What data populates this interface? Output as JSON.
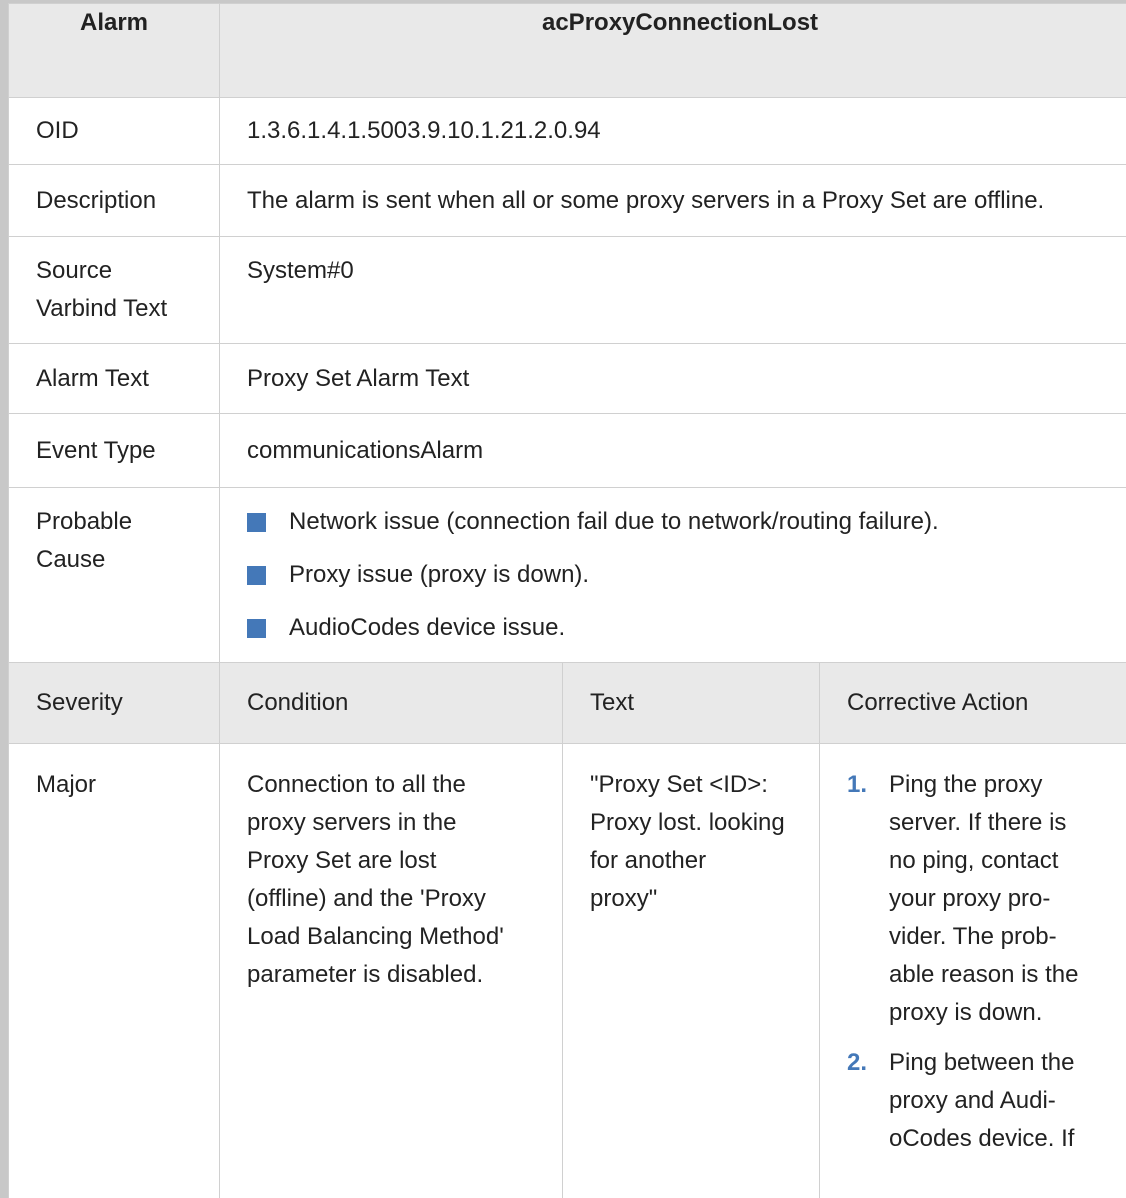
{
  "header": {
    "col_label": "Alarm",
    "col_value": "acProxyConnectionLost"
  },
  "rows": {
    "oid": {
      "label": "OID",
      "value": "1.3.6.1.4.1.5003.9.10.1.21.2.0.94"
    },
    "description": {
      "label": "Description",
      "value": "The alarm is sent when all or some proxy servers in a Proxy Set are offline."
    },
    "source": {
      "label": "Source\nVarbind Text",
      "value": "System#0"
    },
    "alarm_text": {
      "label": "Alarm Text",
      "value": "Proxy Set Alarm Text"
    },
    "event_type": {
      "label": "Event Type",
      "value": "communicationsAlarm"
    },
    "probable_cause": {
      "label": "Probable\nCause",
      "items": [
        "Network issue (connection fail due to network/routing failure).",
        "Proxy issue (proxy is down).",
        "AudioCodes device issue."
      ]
    }
  },
  "severity_table": {
    "headers": {
      "severity": "Severity",
      "condition": "Condition",
      "text": "Text",
      "action": "Corrective Action"
    },
    "major": {
      "severity": "Major",
      "condition": "Connection to all the\nproxy servers in the\nProxy Set are lost\n(offline) and the 'Proxy\nLoad Balancing Method'\nparameter is disabled.",
      "text": "\"Proxy Set <ID>:\nProxy lost. looking\nfor another\nproxy\"",
      "actions": [
        {
          "num": "1.",
          "text": "Ping the proxy\nserver. If there is\nno ping, contact\nyour proxy pro-\nvider. The prob-\nable reason is the\nproxy is down."
        },
        {
          "num": "2.",
          "text": "Ping between the\nproxy and Audi-\noCodes device. If"
        }
      ]
    }
  },
  "colors": {
    "header_bg": "#e9e9e9",
    "border": "#d0d0d0",
    "accent": "#4478b8"
  }
}
